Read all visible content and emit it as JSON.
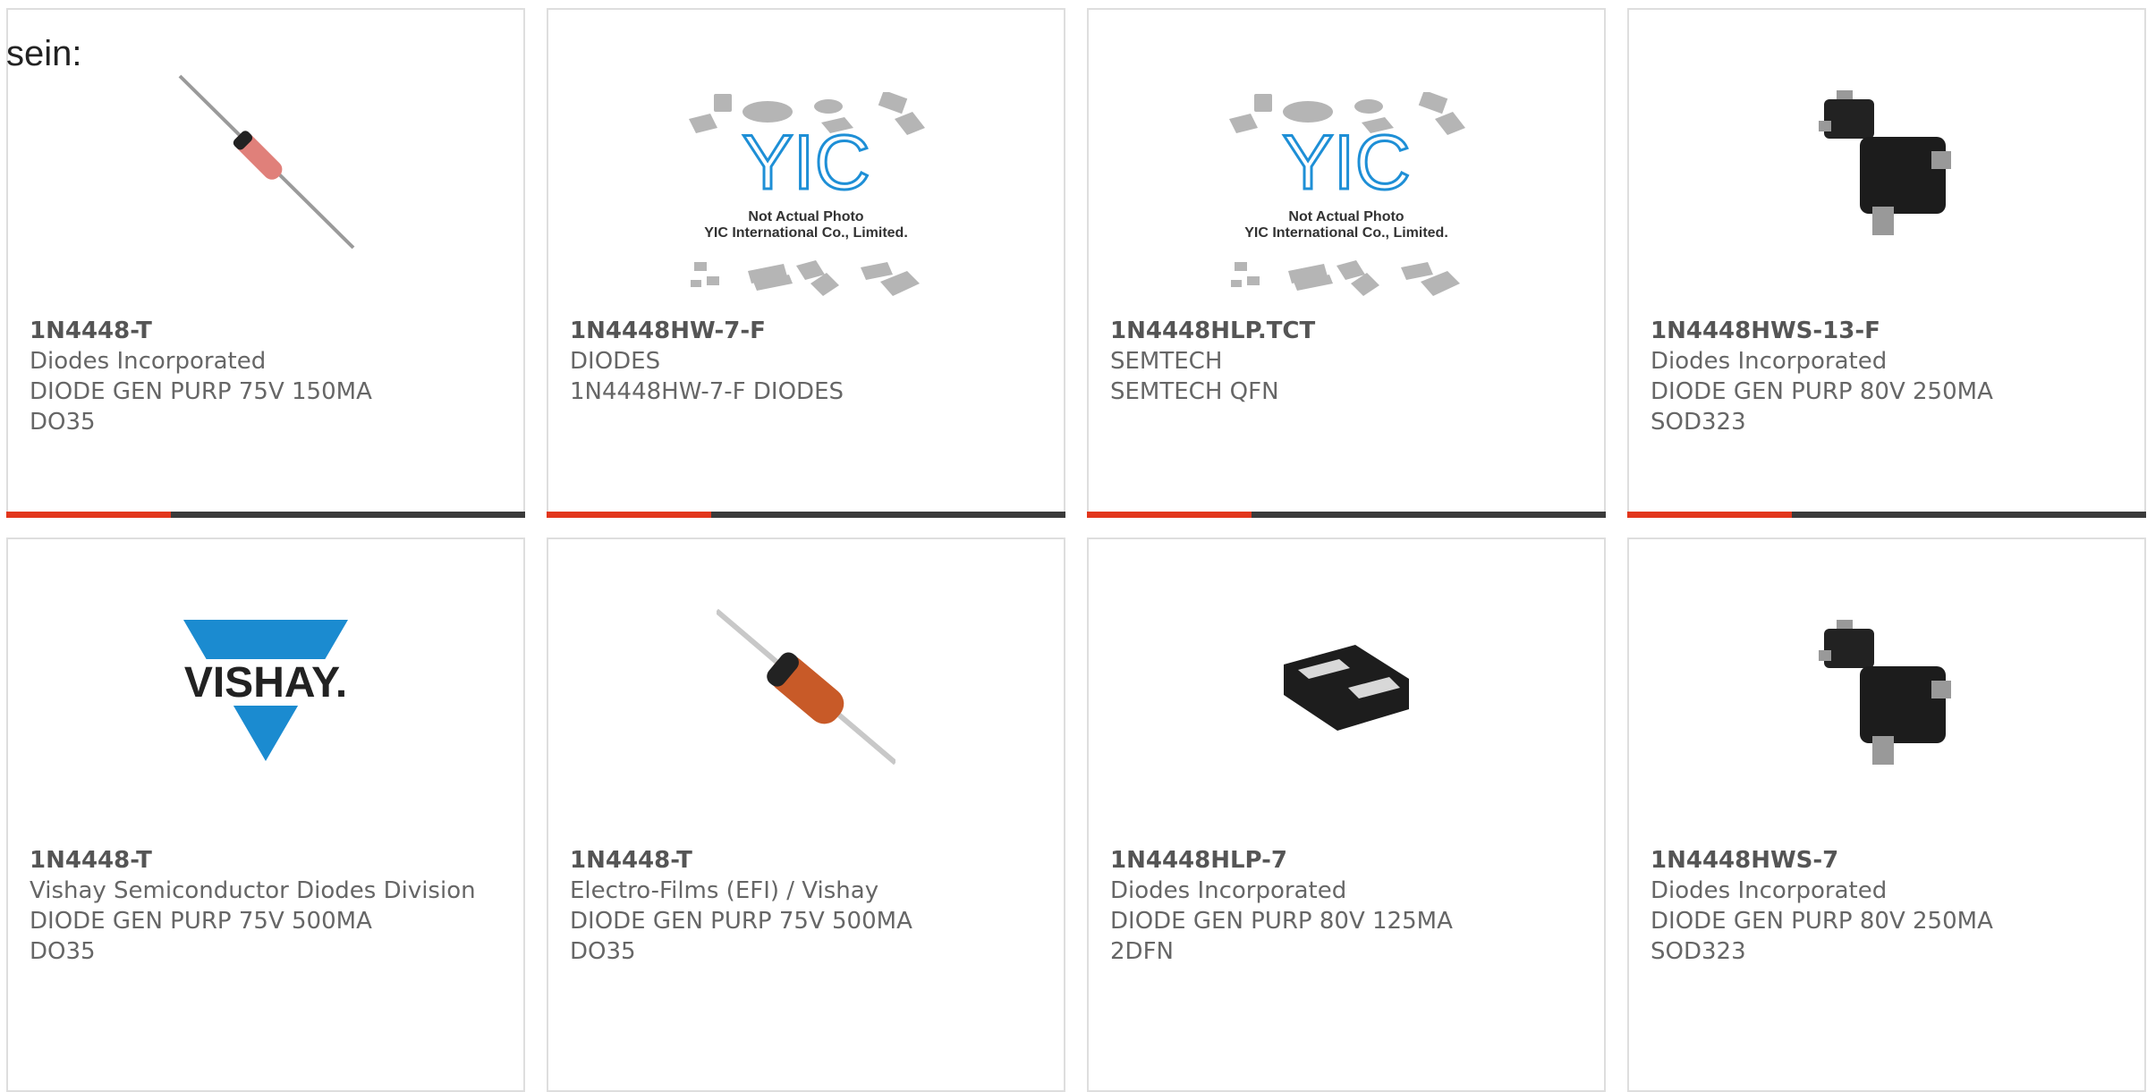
{
  "intro_text": "sein:",
  "colors": {
    "accent": "#e2361c",
    "bar": "#3a3a3a",
    "border": "#dedede",
    "text": "#666666"
  },
  "cards": [
    {
      "mpn": "1N4448-T",
      "manufacturer": "Diodes Incorporated",
      "desc": "DIODE GEN PURP 75V 150MA",
      "package": "DO35",
      "image": "axial-diode-red-photo"
    },
    {
      "mpn": "1N4448HW-7-F",
      "manufacturer": "DIODES",
      "desc": "1N4448HW-7-F DIODES",
      "package": "",
      "image": "yic-placeholder",
      "placeholder_line1": "Not Actual Photo",
      "placeholder_line2": "YIC International Co., Limited."
    },
    {
      "mpn": "1N4448HLP.TCT",
      "manufacturer": "SEMTECH",
      "desc": "SEMTECH QFN",
      "package": "",
      "image": "yic-placeholder",
      "placeholder_line1": "Not Actual Photo",
      "placeholder_line2": "YIC International Co., Limited."
    },
    {
      "mpn": "1N4448HWS-13-F",
      "manufacturer": "Diodes Incorporated",
      "desc": "DIODE GEN PURP 80V 250MA",
      "package": "SOD323",
      "image": "sod323-photo"
    },
    {
      "mpn": "1N4448-T",
      "manufacturer": "Vishay Semiconductor Diodes Division",
      "desc": "DIODE GEN PURP 75V 500MA",
      "package": "DO35",
      "image": "vishay-logo",
      "logo_text": "VISHAY."
    },
    {
      "mpn": "1N4448-T",
      "manufacturer": "Electro-Films (EFI) / Vishay",
      "desc": "DIODE GEN PURP 75V 500MA",
      "package": "DO35",
      "image": "axial-diode-orange-photo"
    },
    {
      "mpn": "1N4448HLP-7",
      "manufacturer": "Diodes Incorporated",
      "desc": "DIODE GEN PURP 80V 125MA",
      "package": "2DFN",
      "image": "dfn-package-photo"
    },
    {
      "mpn": "1N4448HWS-7",
      "manufacturer": "Diodes Incorporated",
      "desc": "DIODE GEN PURP 80V 250MA",
      "package": "SOD323",
      "image": "sod323-photo"
    }
  ]
}
